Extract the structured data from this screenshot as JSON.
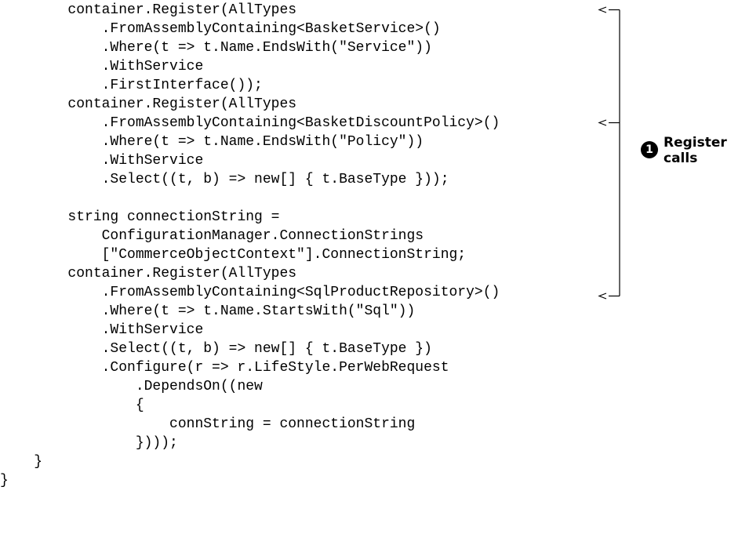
{
  "code_lines": [
    "        container.Register(AllTypes",
    "            .FromAssemblyContaining<BasketService>()",
    "            .Where(t => t.Name.EndsWith(\"Service\"))",
    "            .WithService",
    "            .FirstInterface());",
    "        container.Register(AllTypes",
    "            .FromAssemblyContaining<BasketDiscountPolicy>()",
    "            .Where(t => t.Name.EndsWith(\"Policy\"))",
    "            .WithService",
    "            .Select((t, b) => new[] { t.BaseType }));",
    "",
    "        string connectionString =",
    "            ConfigurationManager.ConnectionStrings",
    "            [\"CommerceObjectContext\"].ConnectionString;",
    "        container.Register(AllTypes",
    "            .FromAssemblyContaining<SqlProductRepository>()",
    "            .Where(t => t.Name.StartsWith(\"Sql\"))",
    "            .WithService",
    "            .Select((t, b) => new[] { t.BaseType })",
    "            .Configure(r => r.LifeStyle.PerWebRequest",
    "                .DependsOn((new",
    "                {",
    "                    connString = connectionString",
    "                })));",
    "    }",
    "}"
  ],
  "annotation": {
    "number": "1",
    "label_line1": "Register",
    "label_line2": "calls"
  }
}
